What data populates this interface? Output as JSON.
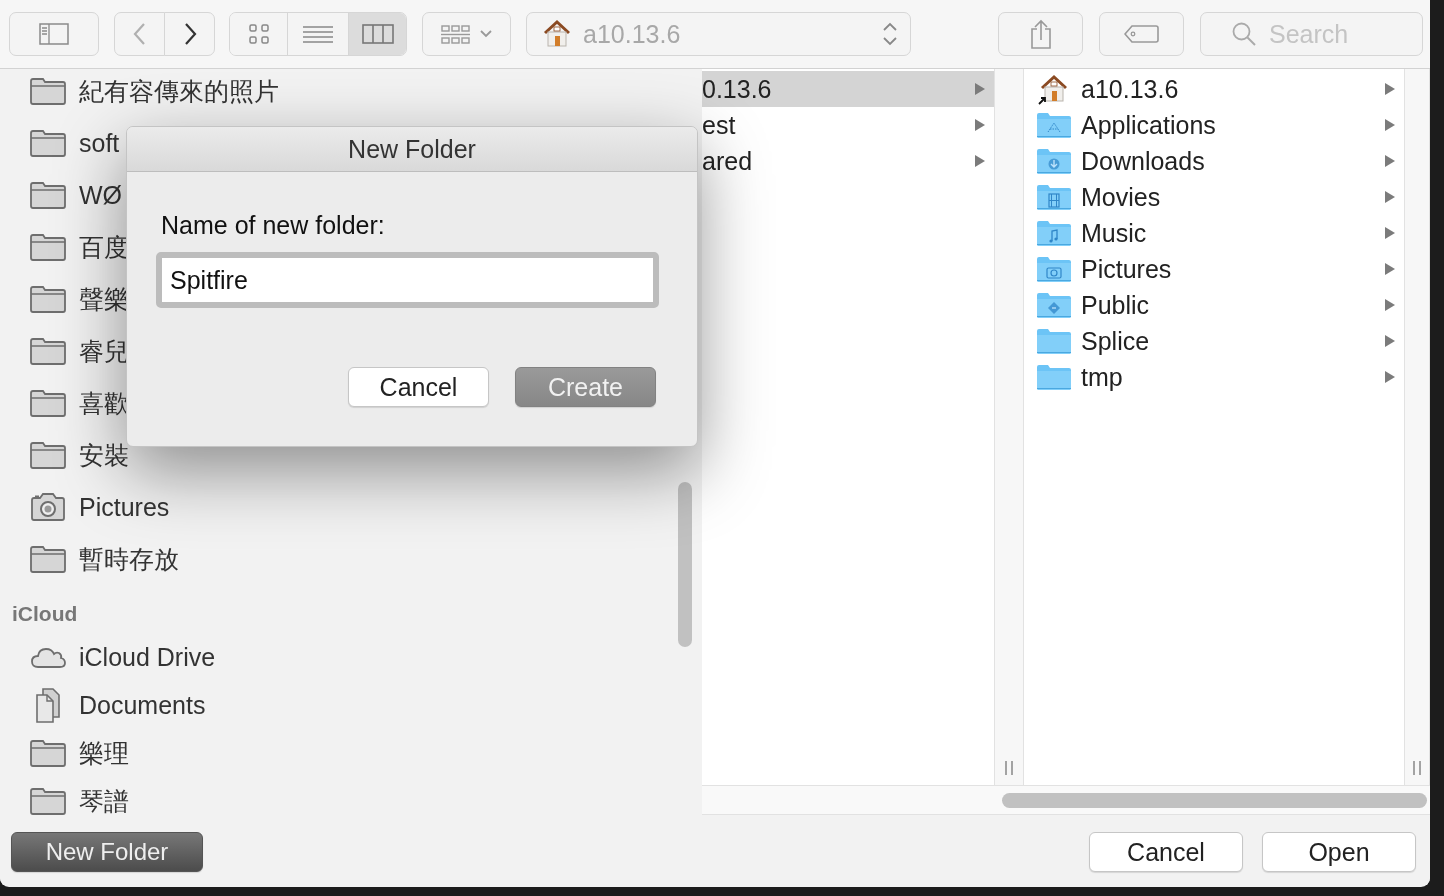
{
  "toolbar": {
    "back": {
      "disabled": true
    },
    "forward": {
      "disabled": false
    },
    "view_modes": [
      {
        "kind": "icons",
        "selected": false
      },
      {
        "kind": "list",
        "selected": false
      },
      {
        "kind": "columns",
        "selected": true
      }
    ],
    "path": {
      "label": "a10.13.6"
    },
    "search": {
      "placeholder": "Search"
    }
  },
  "sidebar": {
    "sections": [
      {
        "items": [
          {
            "label": "紀有容傳來的照片",
            "kind": "folder"
          },
          {
            "label": "soft",
            "kind": "folder"
          },
          {
            "label": "WØ",
            "kind": "folder"
          },
          {
            "label": "百度",
            "kind": "folder"
          },
          {
            "label": "聲樂",
            "kind": "folder"
          },
          {
            "label": "睿兒",
            "kind": "folder"
          },
          {
            "label": "喜歡",
            "kind": "folder"
          },
          {
            "label": "安裝",
            "kind": "folder"
          },
          {
            "label": "Pictures",
            "kind": "camera"
          },
          {
            "label": "暫時存放",
            "kind": "folder"
          }
        ]
      },
      {
        "title": "iCloud",
        "items": [
          {
            "label": "iCloud Drive",
            "kind": "cloud"
          },
          {
            "label": "Documents",
            "kind": "documents"
          },
          {
            "label": "樂理",
            "kind": "folder"
          },
          {
            "label": "琴譜",
            "kind": "folder"
          }
        ]
      }
    ]
  },
  "browser": {
    "columns": [
      {
        "items": [
          {
            "label": "0.13.6",
            "selected": true
          },
          {
            "label": "est",
            "selected": false
          },
          {
            "label": "ared",
            "selected": false
          }
        ]
      },
      {
        "items": [
          {
            "label": "a10.13.6",
            "kind": "home",
            "selected": false
          },
          {
            "label": "Applications",
            "kind": "applications",
            "selected": false
          },
          {
            "label": "Downloads",
            "kind": "downloads",
            "selected": false
          },
          {
            "label": "Movies",
            "kind": "movies",
            "selected": false
          },
          {
            "label": "Music",
            "kind": "music",
            "selected": false
          },
          {
            "label": "Pictures",
            "kind": "pictures",
            "selected": false
          },
          {
            "label": "Public",
            "kind": "public",
            "selected": false
          },
          {
            "label": "Splice",
            "kind": "plain",
            "selected": false
          },
          {
            "label": "tmp",
            "kind": "plain",
            "selected": false
          }
        ]
      }
    ]
  },
  "dialog": {
    "title": "New Folder",
    "prompt": "Name of new folder:",
    "value": "Spitfire",
    "buttons": [
      {
        "label": "Cancel",
        "kind": "normal"
      },
      {
        "label": "Create",
        "kind": "default"
      }
    ]
  },
  "footer": {
    "new_folder": {
      "label": "New Folder"
    },
    "buttons": [
      {
        "label": "Cancel",
        "kind": "normal"
      },
      {
        "label": "Open",
        "kind": "normal"
      }
    ]
  }
}
